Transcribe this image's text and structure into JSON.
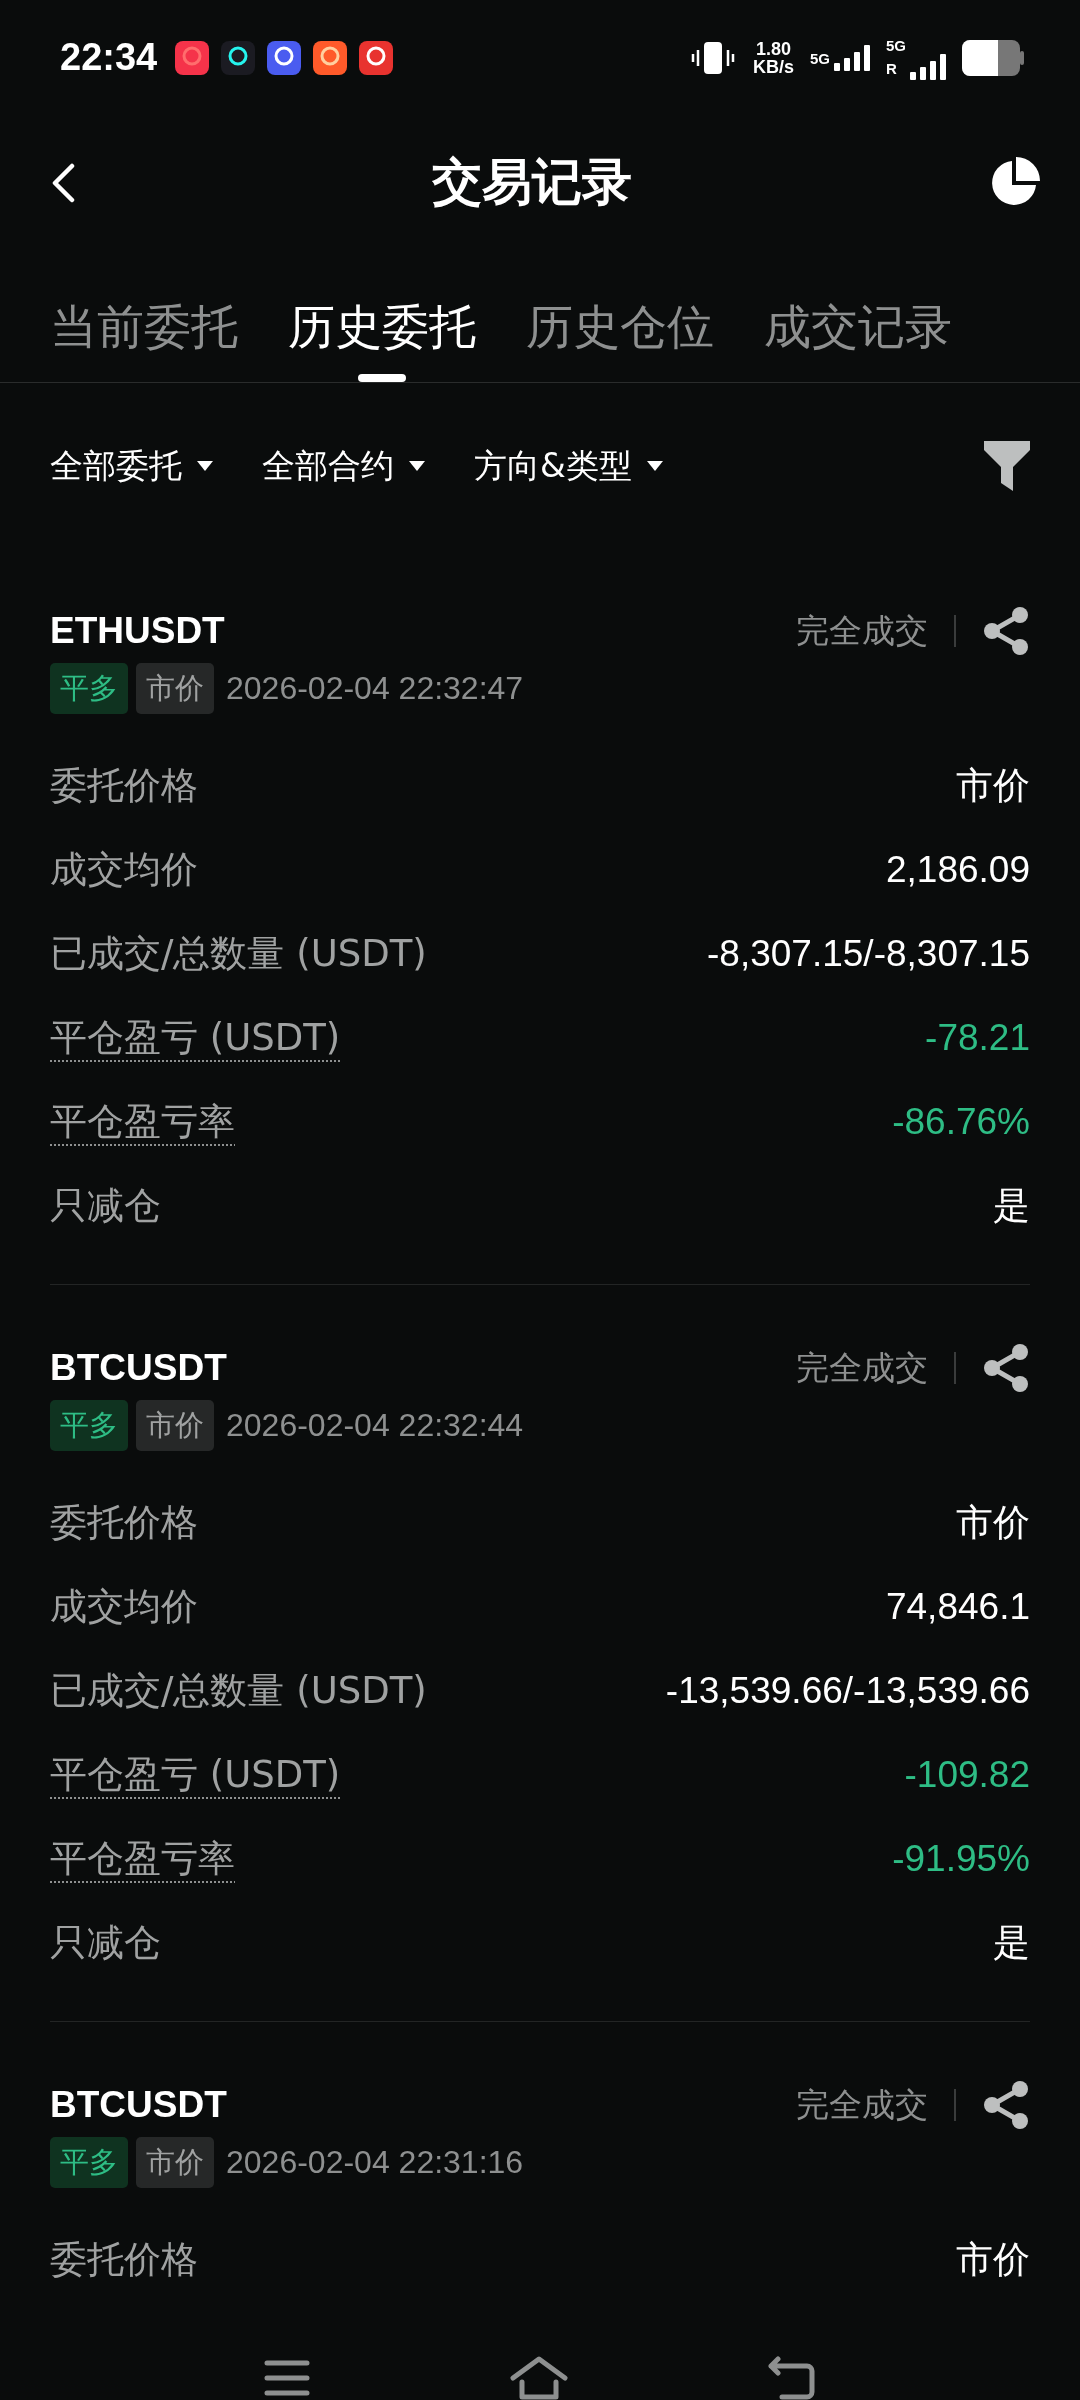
{
  "status_bar": {
    "time": "22:34",
    "speed_value": "1.80",
    "speed_unit": "KB/s",
    "sim1": "5G",
    "sim2": "5G",
    "roaming": "R"
  },
  "header": {
    "title": "交易记录"
  },
  "tabs": [
    {
      "label": "当前委托",
      "selected": false
    },
    {
      "label": "历史委托",
      "selected": true
    },
    {
      "label": "历史仓位",
      "selected": false
    },
    {
      "label": "成交记录",
      "selected": false
    }
  ],
  "filters": [
    {
      "label": "全部委托"
    },
    {
      "label": "全部合约"
    },
    {
      "label": "方向&类型"
    }
  ],
  "orders": [
    {
      "symbol": "ETHUSDT",
      "status": "完全成交",
      "tags": [
        {
          "kind": "side",
          "text": "平多"
        },
        {
          "kind": "type",
          "text": "市价"
        }
      ],
      "time": "2026-02-04 22:32:47",
      "rows": [
        {
          "label": "委托价格",
          "tooltip": false,
          "value": "市价",
          "color": "#ffffff"
        },
        {
          "label": "成交均价",
          "tooltip": false,
          "value": "2,186.09",
          "color": "#ffffff"
        },
        {
          "label": "已成交/总数量 (USDT)",
          "tooltip": false,
          "value": "-8,307.15/-8,307.15",
          "color": "#ffffff"
        },
        {
          "label": "平仓盈亏 (USDT)",
          "tooltip": true,
          "value": "-78.21",
          "color": "#2ebd85"
        },
        {
          "label": "平仓盈亏率",
          "tooltip": true,
          "value": "-86.76%",
          "color": "#2ebd85"
        },
        {
          "label": "只减仓",
          "tooltip": false,
          "value": "是",
          "color": "#ffffff"
        }
      ]
    },
    {
      "symbol": "BTCUSDT",
      "status": "完全成交",
      "tags": [
        {
          "kind": "side",
          "text": "平多"
        },
        {
          "kind": "type",
          "text": "市价"
        }
      ],
      "time": "2026-02-04 22:32:44",
      "rows": [
        {
          "label": "委托价格",
          "tooltip": false,
          "value": "市价",
          "color": "#ffffff"
        },
        {
          "label": "成交均价",
          "tooltip": false,
          "value": "74,846.1",
          "color": "#ffffff"
        },
        {
          "label": "已成交/总数量 (USDT)",
          "tooltip": false,
          "value": "-13,539.66/-13,539.66",
          "color": "#ffffff"
        },
        {
          "label": "平仓盈亏 (USDT)",
          "tooltip": true,
          "value": "-109.82",
          "color": "#2ebd85"
        },
        {
          "label": "平仓盈亏率",
          "tooltip": true,
          "value": "-91.95%",
          "color": "#2ebd85"
        },
        {
          "label": "只减仓",
          "tooltip": false,
          "value": "是",
          "color": "#ffffff"
        }
      ]
    },
    {
      "symbol": "BTCUSDT",
      "status": "完全成交",
      "tags": [
        {
          "kind": "side",
          "text": "平多"
        },
        {
          "kind": "type",
          "text": "市价"
        }
      ],
      "time": "2026-02-04 22:31:16",
      "rows": [
        {
          "label": "委托价格",
          "tooltip": false,
          "value": "市价",
          "color": "#ffffff"
        }
      ]
    }
  ]
}
